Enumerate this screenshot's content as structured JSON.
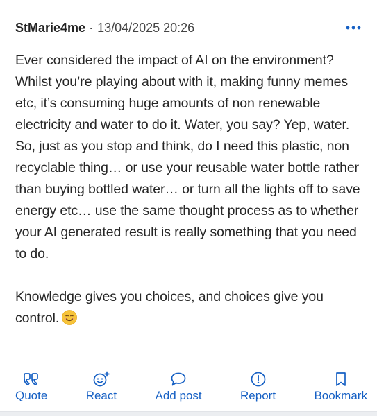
{
  "post": {
    "author": "StMarie4me",
    "separator": "·",
    "timestamp": "13/04/2025 20:26",
    "paragraph1": "Ever considered the impact of AI on the environment? Whilst you’re playing about with it, making funny memes etc, it’s consuming huge amounts of non renewable electricity and water to do it. Water, you say? Yep, water.",
    "paragraph2": "So, just as you stop and think, do I need this plastic, non recyclable thing… or use your reusable water bottle rather than buying bottled water… or turn all the lights off to save energy etc… use the same thought process as to whether your AI generated result is really something that you need to do.",
    "paragraph3": "Knowledge gives you choices, and choices give you control.",
    "emoji": "smiling-face-emoji"
  },
  "actions": [
    {
      "label": "Quote",
      "icon": "quote-icon"
    },
    {
      "label": "React",
      "icon": "smiley-plus-icon"
    },
    {
      "label": "Add post",
      "icon": "speech-bubble-icon"
    },
    {
      "label": "Report",
      "icon": "alert-circle-icon"
    },
    {
      "label": "Bookmark",
      "icon": "bookmark-icon"
    }
  ],
  "colors": {
    "accent": "#1660c4",
    "text": "#262626",
    "divider": "#e6e6e6"
  }
}
